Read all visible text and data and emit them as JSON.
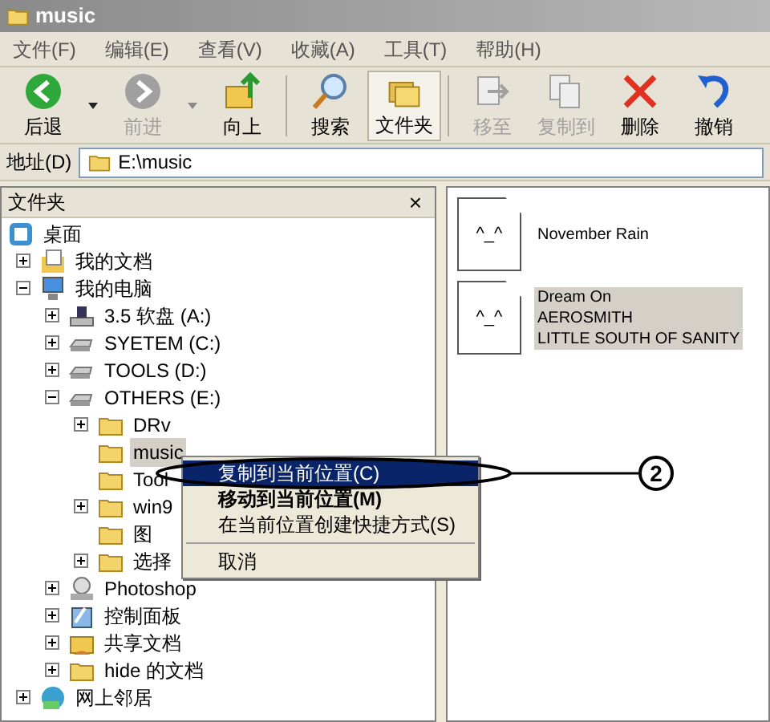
{
  "window": {
    "title": "music"
  },
  "menu": [
    "文件(F)",
    "编辑(E)",
    "查看(V)",
    "收藏(A)",
    "工具(T)",
    "帮助(H)"
  ],
  "toolbar": [
    {
      "kind": "back",
      "label": "后退",
      "disabled": false,
      "selected": false,
      "dropdown": true
    },
    {
      "kind": "forward",
      "label": "前进",
      "disabled": true,
      "selected": false,
      "dropdown": true
    },
    {
      "kind": "up",
      "label": "向上",
      "disabled": false,
      "selected": false,
      "dropdown": false
    },
    {
      "kind": "search",
      "label": "搜索",
      "disabled": false,
      "selected": false,
      "dropdown": false
    },
    {
      "kind": "folders",
      "label": "文件夹",
      "disabled": false,
      "selected": true,
      "dropdown": false
    },
    {
      "kind": "move",
      "label": "移至",
      "disabled": true,
      "selected": false,
      "dropdown": false
    },
    {
      "kind": "copy",
      "label": "复制到",
      "disabled": true,
      "selected": false,
      "dropdown": false
    },
    {
      "kind": "delete",
      "label": "删除",
      "disabled": false,
      "selected": false,
      "dropdown": false
    },
    {
      "kind": "undo",
      "label": "撤销",
      "disabled": false,
      "selected": false,
      "dropdown": false
    }
  ],
  "address": {
    "label": "地址(D)",
    "value": "E:\\music"
  },
  "folder_pane": {
    "title": "文件夹",
    "close": "×",
    "tree": [
      {
        "label": "桌面",
        "kind": "desktop",
        "selected": false,
        "children": [
          {
            "label": "我的文档",
            "kind": "documents",
            "expanded": false,
            "selected": false
          },
          {
            "label": "我的电脑",
            "kind": "computer",
            "expanded": true,
            "selected": false,
            "children": [
              {
                "label": "3.5 软盘 (A:)",
                "kind": "floppy",
                "expanded": false,
                "selected": false
              },
              {
                "label": "SYETEM (C:)",
                "kind": "drive",
                "expanded": false,
                "selected": false
              },
              {
                "label": "TOOLS (D:)",
                "kind": "drive",
                "expanded": false,
                "selected": false
              },
              {
                "label": "OTHERS (E:)",
                "kind": "drive",
                "expanded": true,
                "selected": false,
                "children": [
                  {
                    "label": "DRv",
                    "kind": "folder",
                    "expanded": false,
                    "selected": false
                  },
                  {
                    "label": "music",
                    "kind": "folder",
                    "selected": true
                  },
                  {
                    "label": "Tool",
                    "kind": "folder",
                    "selected": false
                  },
                  {
                    "label": "win9",
                    "kind": "folder",
                    "expanded": false,
                    "selected": false
                  },
                  {
                    "label": "图",
                    "kind": "folder",
                    "selected": false
                  },
                  {
                    "label": "选择",
                    "kind": "folder",
                    "expanded": false,
                    "selected": false
                  }
                ]
              },
              {
                "label": "Photoshop",
                "kind": "cd",
                "expanded": false,
                "selected": false
              },
              {
                "label": "控制面板",
                "kind": "control-panel",
                "expanded": false,
                "selected": false
              },
              {
                "label": "共享文档",
                "kind": "shared",
                "expanded": false,
                "selected": false
              },
              {
                "label": "hide 的文档",
                "kind": "folder",
                "expanded": false,
                "selected": false
              }
            ]
          },
          {
            "label": "网上邻居",
            "kind": "network",
            "expanded": false,
            "selected": false
          }
        ]
      }
    ]
  },
  "files": [
    {
      "glyph": "^_^",
      "lines": [
        "November Rain"
      ],
      "selected": false
    },
    {
      "glyph": "^_^",
      "lines": [
        "Dream On",
        "AEROSMITH",
        "LITTLE SOUTH OF SANITY"
      ],
      "selected": true
    }
  ],
  "context_menu": {
    "items": [
      {
        "kind": "item",
        "label": "复制到当前位置(C)",
        "selected": true,
        "bold": false
      },
      {
        "kind": "item",
        "label": "移动到当前位置(M)",
        "selected": false,
        "bold": true
      },
      {
        "kind": "item",
        "label": "在当前位置创建快捷方式(S)",
        "selected": false,
        "bold": false
      },
      {
        "kind": "separator"
      },
      {
        "kind": "item",
        "label": "取消",
        "selected": false,
        "bold": false
      }
    ]
  },
  "callout": {
    "number": "2"
  }
}
